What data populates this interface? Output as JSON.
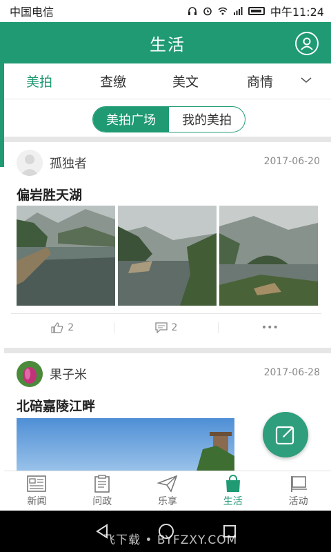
{
  "status_bar": {
    "carrier": "中国电信",
    "time": "中午11:24"
  },
  "header": {
    "title": "生活"
  },
  "category_tabs": [
    {
      "label": "美拍",
      "active": true
    },
    {
      "label": "查缴",
      "active": false
    },
    {
      "label": "美文",
      "active": false
    },
    {
      "label": "商情",
      "active": false
    }
  ],
  "segmented": {
    "left": "美拍广场",
    "right": "我的美拍"
  },
  "posts": [
    {
      "author": "孤独者",
      "date": "2017-06-20",
      "title": "偏岩胜天湖",
      "likes": "2",
      "comments": "2",
      "more": "•••"
    },
    {
      "author": "果子米",
      "date": "2017-06-28",
      "title": "北碚嘉陵江畔"
    }
  ],
  "bottom_nav": [
    {
      "label": "新闻",
      "icon": "newspaper-icon"
    },
    {
      "label": "问政",
      "icon": "clipboard-icon"
    },
    {
      "label": "乐享",
      "icon": "paper-plane-icon"
    },
    {
      "label": "生活",
      "icon": "shopping-bag-icon",
      "active": true
    },
    {
      "label": "活动",
      "icon": "flag-icon"
    }
  ],
  "watermark": "飞下载 • BYFZXY.COM",
  "colors": {
    "accent": "#1f9a73",
    "separator": "#e6e6e6"
  }
}
